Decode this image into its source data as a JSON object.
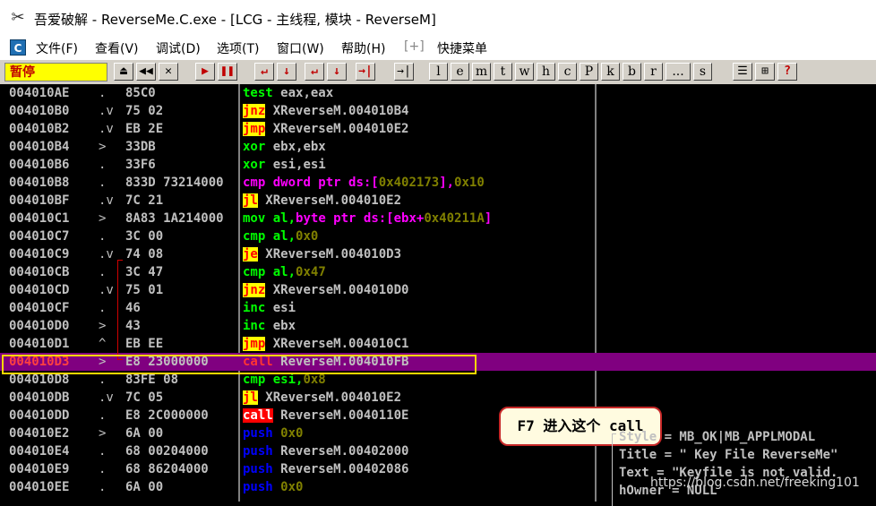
{
  "window": {
    "title": "吾爱破解 - ReverseMe.C.exe - [LCG - 主线程, 模块 - ReverseM]"
  },
  "menu": [
    "文件(F)",
    "查看(V)",
    "调试(D)",
    "选项(T)",
    "窗口(W)",
    "帮助(H)",
    "[+]",
    "快捷菜单"
  ],
  "toolbar": {
    "status": "暂停",
    "ctrl_buttons": [
      "⏏",
      "◀◀",
      "✕",
      "▶",
      "❚❚",
      "↵",
      "↓",
      "↵",
      "↓",
      "→|",
      "→|"
    ],
    "letters": [
      "l",
      "e",
      "m",
      "t",
      "w",
      "h",
      "c",
      "P",
      "k",
      "b",
      "r",
      "...",
      "s"
    ],
    "tail": [
      "☰",
      "⊞",
      "?"
    ]
  },
  "rows": [
    {
      "addr": "004010AE",
      "mark": ".",
      "hex": "85C0",
      "mn": "test",
      "args": [
        [
          "eax,eax",
          "arg"
        ]
      ]
    },
    {
      "addr": "004010B0",
      "mark": ".v",
      "hex": "75 02",
      "mn": "jnz",
      "args": [
        [
          "XReverseM.004010B4",
          "arg"
        ]
      ]
    },
    {
      "addr": "004010B2",
      "mark": ".v",
      "hex": "EB 2E",
      "mn": "jmp",
      "args": [
        [
          "XReverseM.004010E2",
          "arg"
        ]
      ]
    },
    {
      "addr": "004010B4",
      "mark": ">",
      "hex": "33DB",
      "mn": "xor",
      "args": [
        [
          "ebx,ebx",
          "arg"
        ]
      ]
    },
    {
      "addr": "004010B6",
      "mark": ".",
      "hex": "33F6",
      "mn": "xor",
      "args": [
        [
          "esi,esi",
          "arg"
        ]
      ]
    },
    {
      "addr": "004010B8",
      "mark": ".",
      "hex": "833D 73214000",
      "mn": "cmp",
      "args": [
        [
          "dword ptr ds:[",
          "mem"
        ],
        [
          "0x402173",
          "num"
        ],
        [
          "],",
          "mem"
        ],
        [
          "0x10",
          "num"
        ]
      ]
    },
    {
      "addr": "004010BF",
      "mark": ".v",
      "hex": "7C 21",
      "mn": "jl",
      "args": [
        [
          "XReverseM.004010E2",
          "arg"
        ]
      ]
    },
    {
      "addr": "004010C1",
      "mark": ">",
      "hex": "8A83 1A214000",
      "mn": "mov",
      "args": [
        [
          "al,",
          "mov"
        ],
        [
          "byte ptr ds:[ebx+",
          "mem"
        ],
        [
          "0x40211A",
          "num"
        ],
        [
          "]",
          "mem"
        ]
      ]
    },
    {
      "addr": "004010C7",
      "mark": ".",
      "hex": "3C 00",
      "mn": "cmp",
      "args": [
        [
          "al,",
          "mov"
        ],
        [
          "0x0",
          "num"
        ]
      ]
    },
    {
      "addr": "004010C9",
      "mark": ".v",
      "hex": "74 08",
      "mn": "je",
      "args": [
        [
          "XReverseM.004010D3",
          "arg"
        ]
      ]
    },
    {
      "addr": "004010CB",
      "mark": ".",
      "hex": "3C 47",
      "mn": "cmp",
      "args": [
        [
          "al,",
          "mov"
        ],
        [
          "0x47",
          "num"
        ]
      ]
    },
    {
      "addr": "004010CD",
      "mark": ".v",
      "hex": "75 01",
      "mn": "jnz",
      "args": [
        [
          "XReverseM.004010D0",
          "arg"
        ]
      ]
    },
    {
      "addr": "004010CF",
      "mark": ".",
      "hex": "46",
      "mn": "inc",
      "args": [
        [
          "esi",
          "arg"
        ]
      ]
    },
    {
      "addr": "004010D0",
      "mark": ">",
      "hex": "43",
      "mn": "inc",
      "args": [
        [
          "ebx",
          "arg"
        ]
      ]
    },
    {
      "addr": "004010D1",
      "mark": "^",
      "hex": "EB EE",
      "mn": "jmp",
      "args": [
        [
          "XReverseM.004010C1",
          "arg"
        ]
      ]
    },
    {
      "addr": "004010D3",
      "mark": ">",
      "hex": "E8 23000000",
      "mn": "call",
      "args": [
        [
          "ReverseM.004010FB",
          "arg"
        ]
      ],
      "selected": true
    },
    {
      "addr": "004010D8",
      "mark": ".",
      "hex": "83FE 08",
      "mn": "cmp",
      "args": [
        [
          "esi,",
          "mov"
        ],
        [
          "0x8",
          "num"
        ]
      ]
    },
    {
      "addr": "004010DB",
      "mark": ".v",
      "hex": "7C 05",
      "mn": "jl",
      "args": [
        [
          "XReverseM.004010E2",
          "arg"
        ]
      ]
    },
    {
      "addr": "004010DD",
      "mark": ".",
      "hex": "E8 2C000000",
      "mn": "call",
      "args": [
        [
          "ReverseM.0040110E",
          "arg"
        ]
      ]
    },
    {
      "addr": "004010E2",
      "mark": ">",
      "hex": "6A 00",
      "mn": "push",
      "args": [
        [
          "0x0",
          "num"
        ]
      ]
    },
    {
      "addr": "004010E4",
      "mark": ".",
      "hex": "68 00204000",
      "mn": "push",
      "args": [
        [
          "ReverseM.00402000",
          "arg"
        ]
      ]
    },
    {
      "addr": "004010E9",
      "mark": ".",
      "hex": "68 86204000",
      "mn": "push",
      "args": [
        [
          "ReverseM.00402086",
          "arg"
        ]
      ]
    },
    {
      "addr": "004010EE",
      "mark": ".",
      "hex": "6A 00",
      "mn": "push",
      "args": [
        [
          "0x0",
          "num"
        ]
      ]
    }
  ],
  "callout": "F7 进入这个 call",
  "comments": [
    "Style = MB_OK|MB_APPLMODAL",
    "Title = \" Key File ReverseMe\"",
    "Text = \"Keyfile is not valid.",
    "hOwner = NULL"
  ],
  "watermark": "https://blog.csdn.net/freeking101"
}
